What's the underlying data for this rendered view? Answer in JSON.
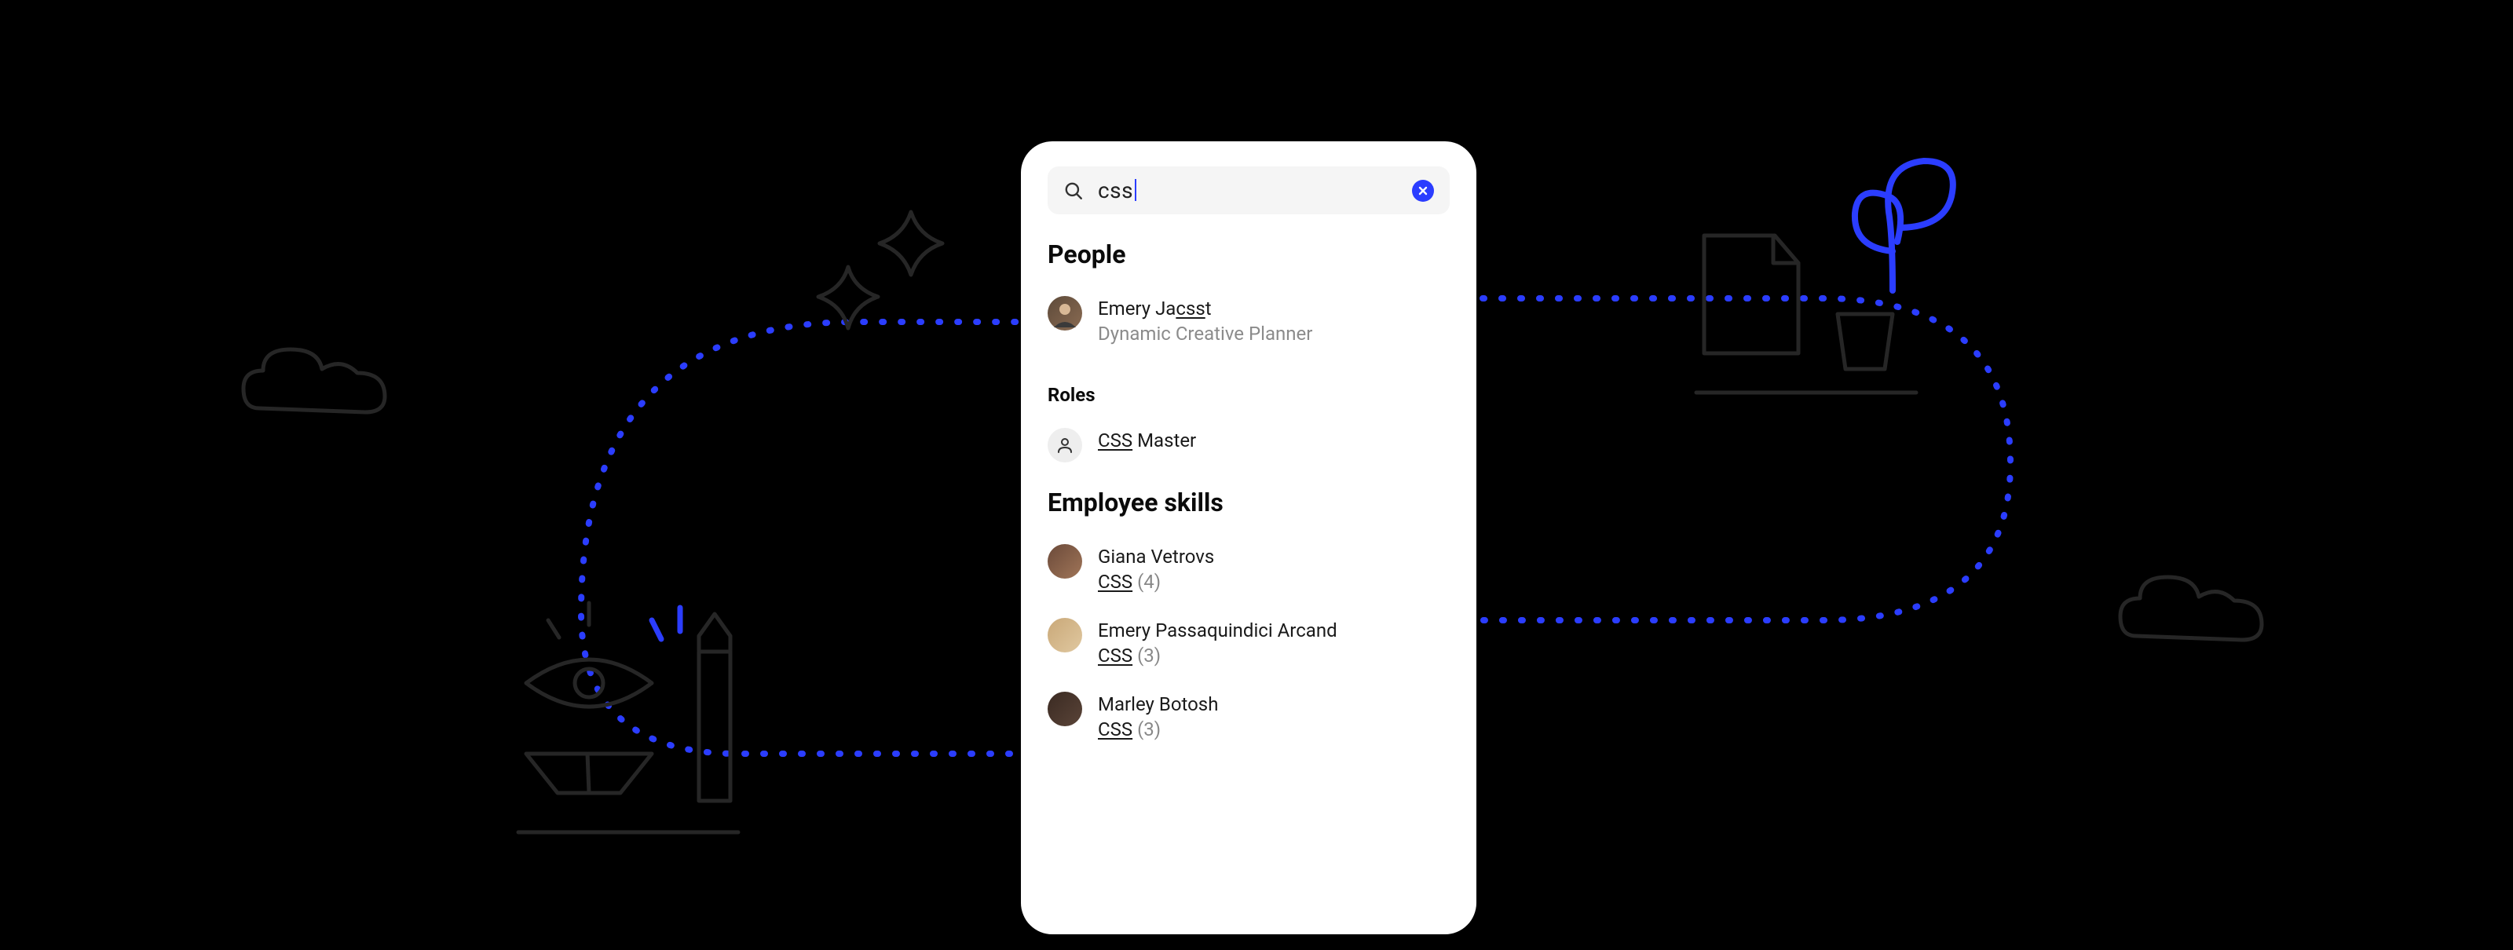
{
  "search": {
    "query": "css"
  },
  "sections": {
    "people": {
      "heading": "People",
      "items": [
        {
          "name_prefix": "Emery Ja",
          "name_match": "css",
          "name_suffix": "t",
          "subtitle": "Dynamic Creative Planner"
        }
      ]
    },
    "roles": {
      "heading": "Roles",
      "items": [
        {
          "match": "CSS",
          "suffix": " Master"
        }
      ]
    },
    "skills": {
      "heading": "Employee skills",
      "items": [
        {
          "name": "Giana Vetrovs",
          "skill_match": "CSS",
          "count": "(4)"
        },
        {
          "name": "Emery Passaquindici Arcand",
          "skill_match": "CSS",
          "count": "(3)"
        },
        {
          "name": "Marley Botosh",
          "skill_match": "CSS",
          "count": "(3)"
        }
      ]
    }
  }
}
